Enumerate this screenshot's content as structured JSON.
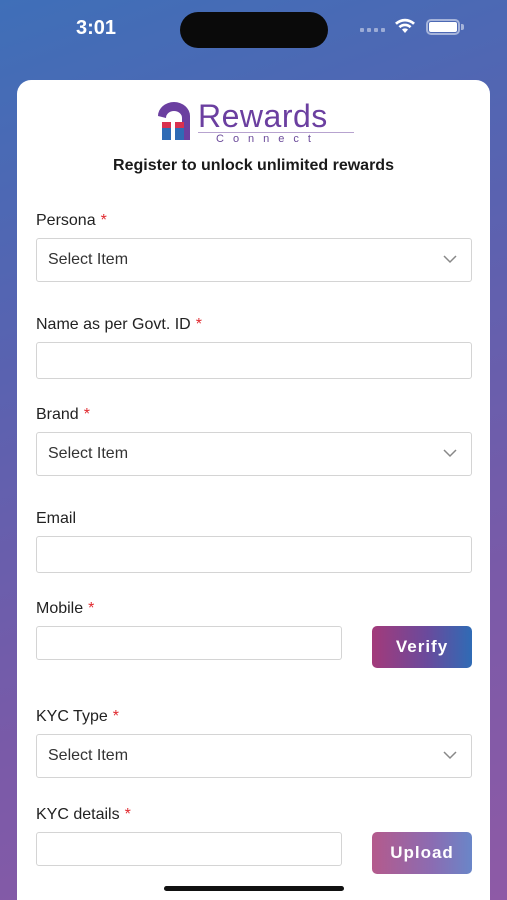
{
  "status_bar": {
    "time": "3:01"
  },
  "logo": {
    "word": "Rewards",
    "sub": "Connect"
  },
  "header": {
    "subtitle": "Register to unlock unlimited rewards"
  },
  "form": {
    "persona": {
      "label": "Persona",
      "required": "*",
      "value": "Select Item"
    },
    "name": {
      "label": "Name as per Govt. ID",
      "required": "*",
      "value": ""
    },
    "brand": {
      "label": "Brand",
      "required": "*",
      "value": "Select Item"
    },
    "email": {
      "label": "Email",
      "value": ""
    },
    "mobile": {
      "label": "Mobile",
      "required": "*",
      "value": "",
      "button": "Verify"
    },
    "kyc_type": {
      "label": "KYC Type",
      "required": "*",
      "value": "Select Item"
    },
    "kyc_details": {
      "label": "KYC details",
      "required": "*",
      "value": "",
      "button": "Upload"
    }
  },
  "colors": {
    "accent_purple": "#6b3fa0",
    "required_red": "#e0282e",
    "gradient_blue": "#2f6bb5",
    "gradient_magenta": "#a33a7a"
  },
  "icons": [
    "wifi-icon",
    "battery-icon",
    "chevron-down-icon",
    "rewards-logo"
  ]
}
